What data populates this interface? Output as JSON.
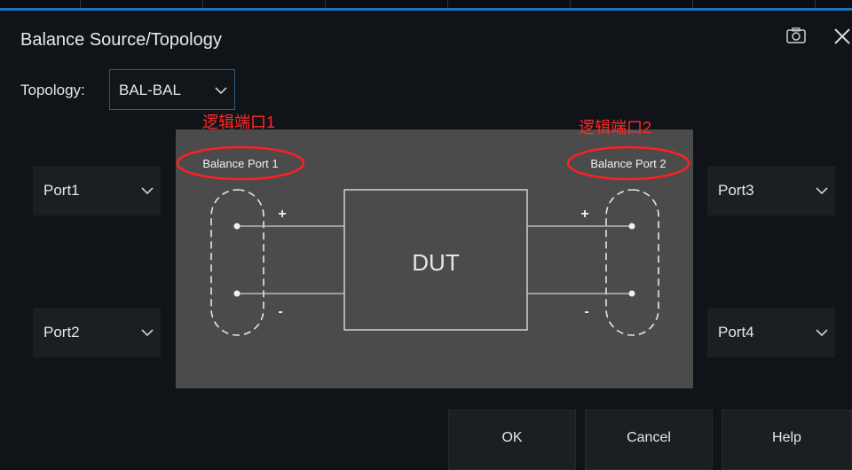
{
  "dialog": {
    "title": "Balance Source/Topology",
    "camera_icon": "camera-icon",
    "close_icon": "close-icon"
  },
  "topology": {
    "label": "Topology:",
    "value": "BAL-BAL"
  },
  "ports": {
    "port1": "Port1",
    "port2": "Port2",
    "port3": "Port3",
    "port4": "Port4"
  },
  "diagram": {
    "balance_port_1": "Balance Port 1",
    "balance_port_2": "Balance Port 2",
    "dut": "DUT",
    "plus": "+",
    "minus": "-"
  },
  "annotations": {
    "logical_port_1": "逻辑端口1",
    "logical_port_2": "逻辑端口2",
    "annotation_color": "#ff2a2a"
  },
  "buttons": {
    "ok": "OK",
    "cancel": "Cancel",
    "help": "Help"
  }
}
